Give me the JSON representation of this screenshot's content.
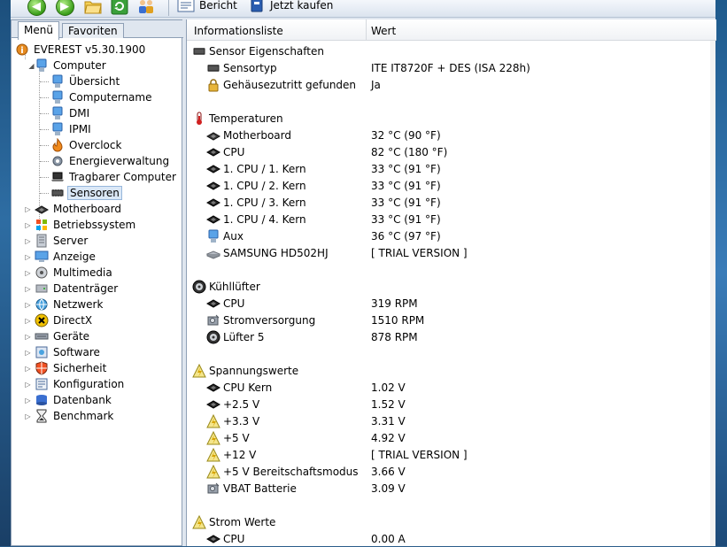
{
  "toolbar": {
    "bericht_label": "Bericht",
    "kaufen_label": "Jetzt kaufen"
  },
  "tabs": {
    "menu": "Menü",
    "favoriten": "Favoriten"
  },
  "tree": {
    "root": "EVEREST v5.30.1900",
    "computer": "Computer",
    "computer_children": [
      "Übersicht",
      "Computername",
      "DMI",
      "IPMI",
      "Overclock",
      "Energieverwaltung",
      "Tragbarer Computer",
      "Sensoren"
    ],
    "sections": [
      "Motherboard",
      "Betriebssystem",
      "Server",
      "Anzeige",
      "Multimedia",
      "Datenträger",
      "Netzwerk",
      "DirectX",
      "Geräte",
      "Software",
      "Sicherheit",
      "Konfiguration",
      "Datenbank",
      "Benchmark"
    ]
  },
  "columns": {
    "col1": "Informationsliste",
    "col2": "Wert"
  },
  "groups": [
    {
      "title": "Sensor Eigenschaften",
      "icon": "chip-icon",
      "items": [
        {
          "k": "Sensortyp",
          "v": "ITE IT8720F + DES  (ISA 228h)",
          "icon": "chip-icon"
        },
        {
          "k": "Gehäusezutritt gefunden",
          "v": "Ja",
          "icon": "lock-icon"
        }
      ]
    },
    {
      "title": "Temperaturen",
      "icon": "thermometer-icon",
      "items": [
        {
          "k": "Motherboard",
          "v": "32 °C  (90 °F)",
          "icon": "motherboard-icon"
        },
        {
          "k": "CPU",
          "v": "82 °C  (180 °F)",
          "icon": "cpu-icon"
        },
        {
          "k": "1. CPU / 1. Kern",
          "v": "33 °C  (91 °F)",
          "icon": "cpu-icon"
        },
        {
          "k": "1. CPU / 2. Kern",
          "v": "33 °C  (91 °F)",
          "icon": "cpu-icon"
        },
        {
          "k": "1. CPU / 3. Kern",
          "v": "33 °C  (91 °F)",
          "icon": "cpu-icon"
        },
        {
          "k": "1. CPU / 4. Kern",
          "v": "33 °C  (91 °F)",
          "icon": "cpu-icon"
        },
        {
          "k": "Aux",
          "v": "36 °C  (97 °F)",
          "icon": "computer-icon"
        },
        {
          "k": "SAMSUNG HD502HJ",
          "v": "[ TRIAL VERSION ]",
          "icon": "harddisk-icon"
        }
      ]
    },
    {
      "title": "Kühllüfter",
      "icon": "fan-icon",
      "items": [
        {
          "k": "CPU",
          "v": "319 RPM",
          "icon": "cpu-icon"
        },
        {
          "k": "Stromversorgung",
          "v": "1510 RPM",
          "icon": "power-supply-icon"
        },
        {
          "k": "Lüfter 5",
          "v": "878 RPM",
          "icon": "fan-icon"
        }
      ]
    },
    {
      "title": "Spannungswerte",
      "icon": "voltage-icon",
      "items": [
        {
          "k": "CPU Kern",
          "v": "1.02 V",
          "icon": "cpu-icon"
        },
        {
          "k": "+2.5 V",
          "v": "1.52 V",
          "icon": "cpu-icon"
        },
        {
          "k": "+3.3 V",
          "v": "3.31 V",
          "icon": "voltage-icon"
        },
        {
          "k": "+5 V",
          "v": "4.92 V",
          "icon": "voltage-icon"
        },
        {
          "k": "+12 V",
          "v": "[ TRIAL VERSION ]",
          "icon": "voltage-icon"
        },
        {
          "k": "+5 V Bereitschaftsmodus",
          "v": "3.66 V",
          "icon": "voltage-icon"
        },
        {
          "k": "VBAT Batterie",
          "v": "3.09 V",
          "icon": "power-supply-icon"
        }
      ]
    },
    {
      "title": "Strom Werte",
      "icon": "voltage-icon",
      "items": [
        {
          "k": "CPU",
          "v": "0.00 A",
          "icon": "cpu-icon"
        }
      ]
    }
  ]
}
